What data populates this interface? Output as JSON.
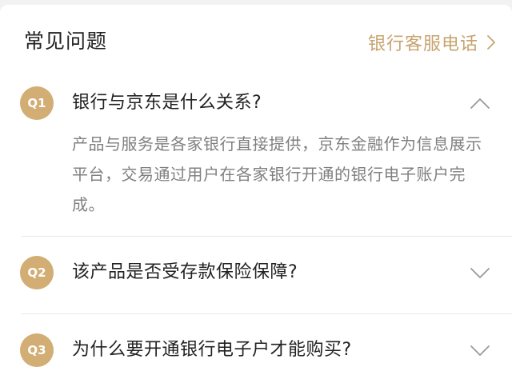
{
  "header": {
    "title": "常见问题",
    "hotline_label": "银行客服电话"
  },
  "faq": {
    "items": [
      {
        "badge": "Q1",
        "question": "银行与京东是什么关系?",
        "expanded": true,
        "answer": "产品与服务是各家银行直接提供，京东金融作为信息展示平台，交易通过用户在各家银行开通的银行电子账户完成。"
      },
      {
        "badge": "Q2",
        "question": "该产品是否受存款保险保障?",
        "expanded": false
      },
      {
        "badge": "Q3",
        "question": "为什么要开通银行电子户才能购买?",
        "expanded": false
      }
    ]
  },
  "colors": {
    "accent_gold": "#c7a46f",
    "badge_gold": "#d2ad74",
    "text_primary": "#222222",
    "text_secondary": "#808080",
    "divider": "#e8e8e8"
  },
  "icons": {
    "hotline": "chevron-right-icon",
    "expanded": "chevron-up-icon",
    "collapsed": "chevron-down-icon"
  }
}
